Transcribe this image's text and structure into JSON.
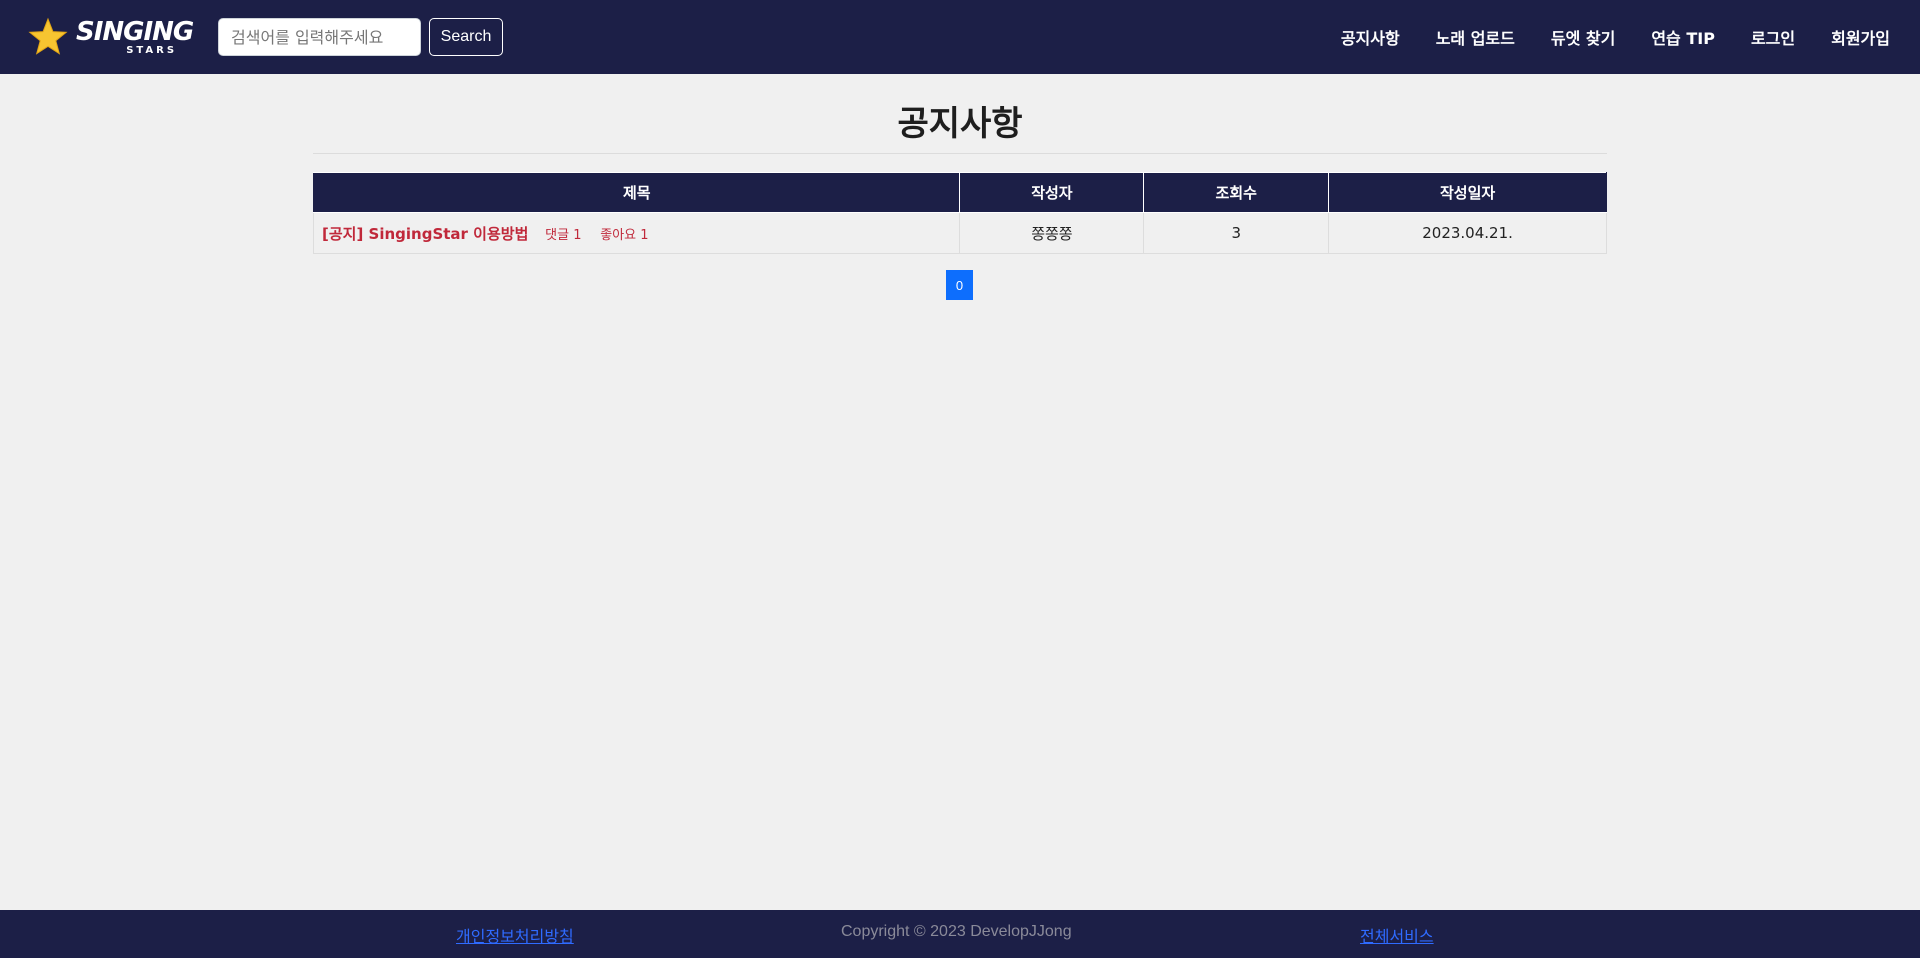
{
  "header": {
    "brand_main": "SINGING",
    "brand_sub": "STARS",
    "search_placeholder": "검색어를 입력해주세요",
    "search_button": "Search",
    "nav": [
      "공지사항",
      "노래 업로드",
      "듀엣 찾기",
      "연습 TIP",
      "로그인",
      "회원가입"
    ]
  },
  "main": {
    "title": "공지사항",
    "columns": [
      "제목",
      "작성자",
      "조회수",
      "작성일자"
    ],
    "rows": [
      {
        "title": "[공지] SingingStar 이용방법",
        "comments": "댓글 1",
        "likes": "좋아요 1",
        "author": "쫑쫑쫑",
        "views": "3",
        "date": "2023.04.21."
      }
    ],
    "pagination": [
      "0"
    ]
  },
  "footer": {
    "privacy": "개인정보처리방침",
    "copyright": "Copyright © 2023 DevelopJJong",
    "all_services": "전체서비스"
  },
  "colors": {
    "header_bg": "#1c1f47",
    "page_bg": "#f0f0f0",
    "post_title": "#c0283a",
    "page_active": "#0d6efd",
    "footer_link": "#2f6bff",
    "star": "#f7c531"
  },
  "icons": {
    "logo": "star-icon"
  }
}
